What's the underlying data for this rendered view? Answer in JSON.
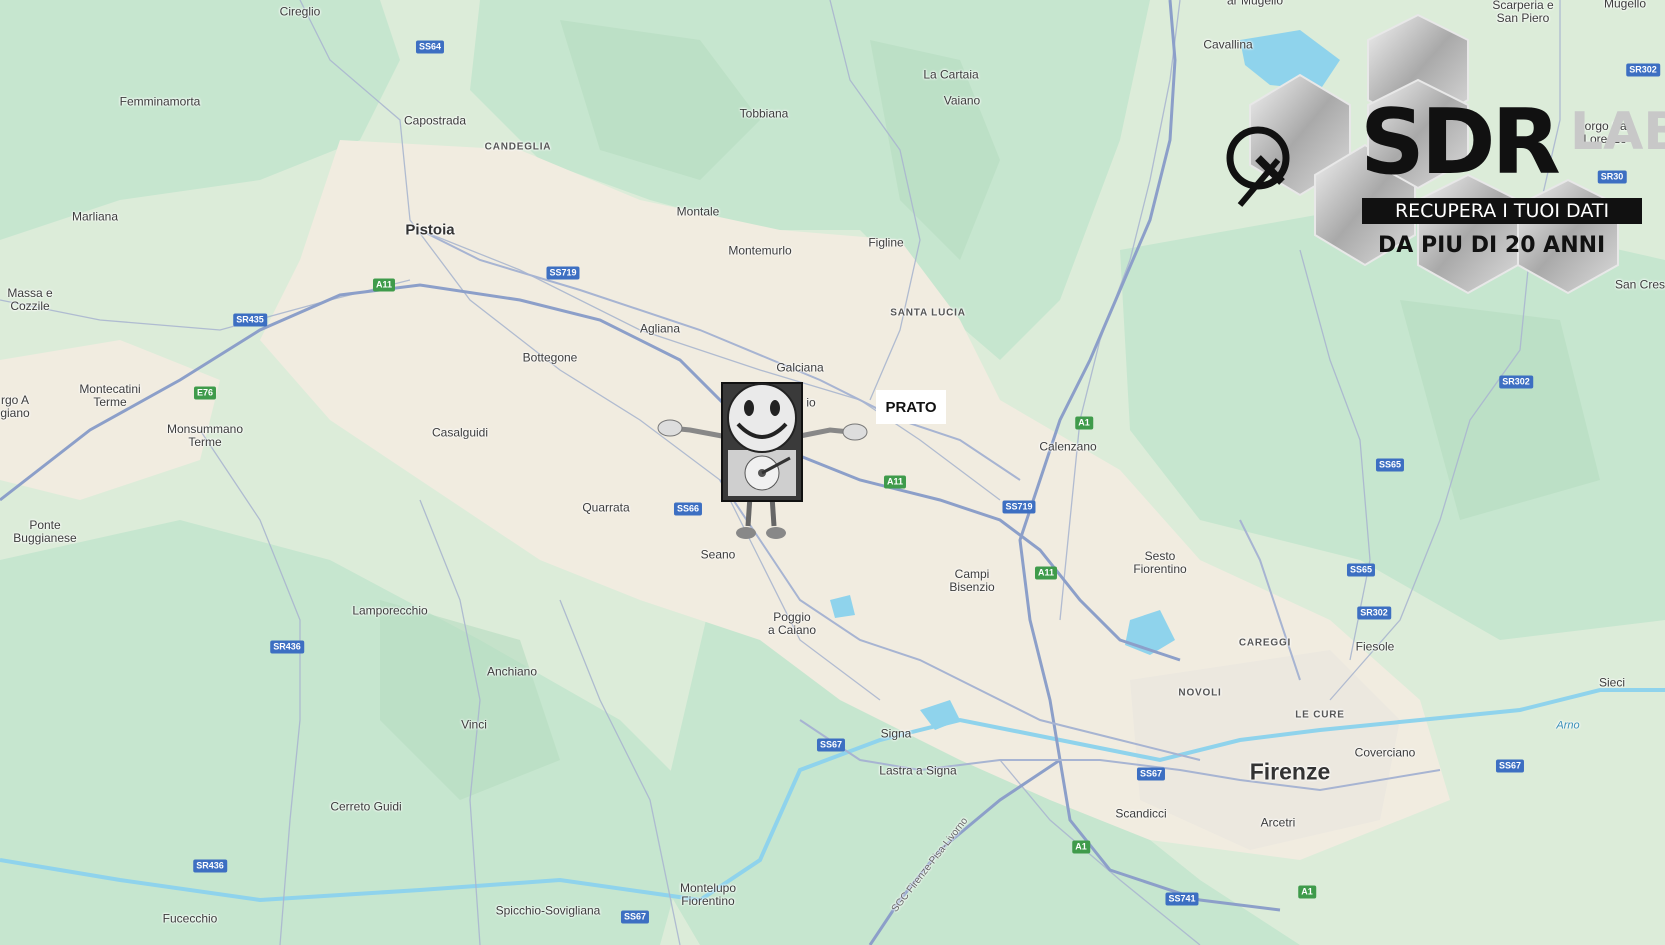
{
  "map": {
    "places": [
      {
        "name": "Cireglio",
        "kind": "town"
      },
      {
        "name": "Femminamorta",
        "kind": "town"
      },
      {
        "name": "Capostrada",
        "kind": "town"
      },
      {
        "name": "CANDEGLIA",
        "kind": "district"
      },
      {
        "name": "Pistoia",
        "kind": "city"
      },
      {
        "name": "Marliana",
        "kind": "town"
      },
      {
        "name": "Massa e\nCozzile",
        "kind": "town"
      },
      {
        "name": "Montecatini\nTerme",
        "kind": "town"
      },
      {
        "name": "rgo A\ngiano",
        "kind": "town"
      },
      {
        "name": "Monsummano\nTerme",
        "kind": "town"
      },
      {
        "name": "Casalguidi",
        "kind": "town"
      },
      {
        "name": "Bottegone",
        "kind": "town"
      },
      {
        "name": "Ponte\nBuggianese",
        "kind": "town"
      },
      {
        "name": "Quarrata",
        "kind": "town"
      },
      {
        "name": "Lamporecchio",
        "kind": "town"
      },
      {
        "name": "Anchiano",
        "kind": "town"
      },
      {
        "name": "Vinci",
        "kind": "town"
      },
      {
        "name": "Cerreto Guidi",
        "kind": "town"
      },
      {
        "name": "Fucecchio",
        "kind": "town"
      },
      {
        "name": "Spicchio-Sovigliana",
        "kind": "town"
      },
      {
        "name": "Montelupo\nFiorentino",
        "kind": "town"
      },
      {
        "name": "Seano",
        "kind": "town"
      },
      {
        "name": "Poggio\na Caiano",
        "kind": "town"
      },
      {
        "name": "Signa",
        "kind": "town"
      },
      {
        "name": "Lastra a Signa",
        "kind": "town"
      },
      {
        "name": "Campi\nBisenzio",
        "kind": "town"
      },
      {
        "name": "Scandicci",
        "kind": "town"
      },
      {
        "name": "Firenze",
        "kind": "bigcity"
      },
      {
        "name": "Arcetri",
        "kind": "town"
      },
      {
        "name": "Coverciano",
        "kind": "town"
      },
      {
        "name": "NOVOLI",
        "kind": "district"
      },
      {
        "name": "CAREGGI",
        "kind": "district"
      },
      {
        "name": "LE CURE",
        "kind": "district"
      },
      {
        "name": "Fiesole",
        "kind": "town"
      },
      {
        "name": "Sesto\nFiorentino",
        "kind": "town"
      },
      {
        "name": "Calenzano",
        "kind": "town"
      },
      {
        "name": "Sieci",
        "kind": "town"
      },
      {
        "name": "Galciana",
        "kind": "town"
      },
      {
        "name": "Aglianа",
        "kind": "town"
      },
      {
        "name": "Montemurlo",
        "kind": "town"
      },
      {
        "name": "Montale",
        "kind": "town"
      },
      {
        "name": "Tobbiana",
        "kind": "town"
      },
      {
        "name": "La Cartaia",
        "kind": "town"
      },
      {
        "name": "Vaiano",
        "kind": "town"
      },
      {
        "name": "Figline",
        "kind": "town"
      },
      {
        "name": "SANTA LUCIA",
        "kind": "district"
      },
      {
        "name": "Cavallina",
        "kind": "town"
      },
      {
        "name": "ar Mugello",
        "kind": "town"
      },
      {
        "name": "Scarperia e\nSan Piero",
        "kind": "town"
      },
      {
        "name": "Mugello",
        "kind": "town"
      },
      {
        "name": "Borgo San\nLorenzo",
        "kind": "town"
      },
      {
        "name": "San Cres",
        "kind": "town"
      },
      {
        "name": "io",
        "kind": "town"
      },
      {
        "name": "Arno",
        "kind": "river"
      }
    ],
    "shields": [
      {
        "label": "SS64",
        "color": "blue"
      },
      {
        "label": "A11",
        "color": "green"
      },
      {
        "label": "SS719",
        "color": "blue"
      },
      {
        "label": "SR435",
        "color": "blue"
      },
      {
        "label": "E76",
        "color": "green"
      },
      {
        "label": "SS66",
        "color": "blue"
      },
      {
        "label": "A11",
        "color": "green"
      },
      {
        "label": "SS719",
        "color": "blue"
      },
      {
        "label": "A1",
        "color": "green"
      },
      {
        "label": "A11",
        "color": "green"
      },
      {
        "label": "SR436",
        "color": "blue"
      },
      {
        "label": "SR436",
        "color": "blue"
      },
      {
        "label": "SS67",
        "color": "blue"
      },
      {
        "label": "SS67",
        "color": "blue"
      },
      {
        "label": "A1",
        "color": "green"
      },
      {
        "label": "SS741",
        "color": "blue"
      },
      {
        "label": "A1",
        "color": "green"
      },
      {
        "label": "SS67",
        "color": "blue"
      },
      {
        "label": "SS67",
        "color": "blue"
      },
      {
        "label": "SR302",
        "color": "blue"
      },
      {
        "label": "SS65",
        "color": "blue"
      },
      {
        "label": "SS65",
        "color": "blue"
      },
      {
        "label": "SR302",
        "color": "blue"
      },
      {
        "label": "SR302",
        "color": "blue"
      },
      {
        "label": "SR30",
        "color": "blue"
      }
    ],
    "road_label": "SGC Firenze-Pisa-Livorno",
    "colors": {
      "land": "#dcecd9",
      "urban": "#f2ece0",
      "forest": "#bfe3c8",
      "water": "#8fd3ec",
      "road": "#9aa9c9",
      "motorway": "#8a9bc6"
    }
  },
  "overlays": {
    "highlight_label": "PRATO",
    "mascot": {
      "icon": "smiley-hard-drive-mascot"
    },
    "logo": {
      "main": "SDR",
      "lab": "LAB",
      "tagline": "RECUPERA I TUOI DATI",
      "subline": "DA  PIU DI 20 ANNI",
      "icon": "hexagon-gauge-icon"
    }
  }
}
